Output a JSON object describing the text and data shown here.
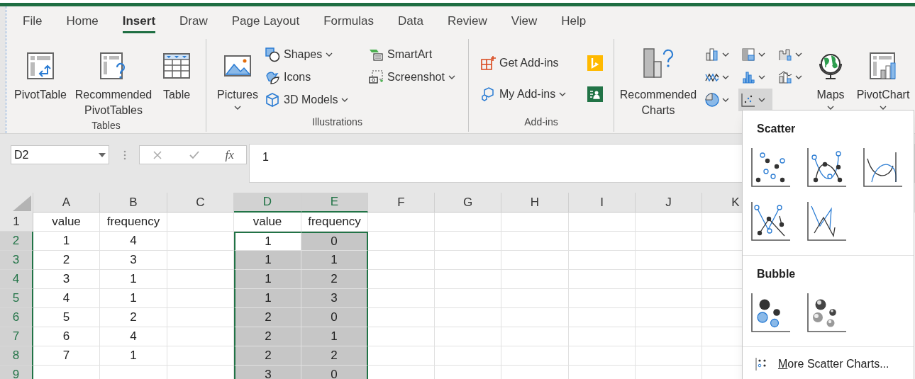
{
  "ribbon_tabs": [
    {
      "label": "File",
      "selected": false
    },
    {
      "label": "Home",
      "selected": false
    },
    {
      "label": "Insert",
      "selected": true
    },
    {
      "label": "Draw",
      "selected": false
    },
    {
      "label": "Page Layout",
      "selected": false
    },
    {
      "label": "Formulas",
      "selected": false
    },
    {
      "label": "Data",
      "selected": false
    },
    {
      "label": "Review",
      "selected": false
    },
    {
      "label": "View",
      "selected": false
    },
    {
      "label": "Help",
      "selected": false
    }
  ],
  "tables_group": {
    "label": "Tables",
    "buttons": [
      {
        "kind": "pivot-table",
        "label": "PivotTable"
      },
      {
        "kind": "recommended-pivot",
        "label": "Recommended PivotTables"
      },
      {
        "kind": "table",
        "label": "Table"
      }
    ]
  },
  "illustrations_group": {
    "label": "Illustrations",
    "pictures": {
      "kind": "pictures",
      "label": "Pictures",
      "has_menu": true
    },
    "columns": [
      [
        {
          "kind": "shapes",
          "label": "Shapes",
          "has_menu": true
        },
        {
          "kind": "icons",
          "label": "Icons",
          "has_menu": false
        },
        {
          "kind": "models",
          "label": "3D Models",
          "has_menu": true
        }
      ],
      [
        {
          "kind": "smartart",
          "label": "SmartArt",
          "has_menu": false
        },
        {
          "kind": "screenshot",
          "label": "Screenshot",
          "has_menu": true
        }
      ]
    ]
  },
  "addins_group": {
    "label": "Add-ins",
    "rows": [
      {
        "kind": "get-addins",
        "label": "Get Add-ins",
        "has_menu": false,
        "side_button": {
          "kind": "bing"
        }
      },
      {
        "kind": "my-addins",
        "label": "My Add-ins",
        "has_menu": true,
        "side_button": {
          "kind": "people"
        }
      }
    ]
  },
  "charts_group": {
    "recommended": {
      "kind": "recommended-charts",
      "label": "Recommended Charts"
    },
    "chart_buttons": [
      {
        "kind": "column",
        "selected": false
      },
      {
        "kind": "hierarchy",
        "selected": false
      },
      {
        "kind": "waterfall",
        "selected": false
      },
      {
        "kind": "line",
        "selected": false
      },
      {
        "kind": "statistic",
        "selected": false
      },
      {
        "kind": "combo",
        "selected": false
      },
      {
        "kind": "pie",
        "selected": false
      },
      {
        "kind": "scatter",
        "selected": true
      }
    ],
    "large": [
      {
        "kind": "maps",
        "label": "Maps",
        "has_menu": true
      },
      {
        "kind": "pivot-chart",
        "label": "PivotChart",
        "has_menu": true
      }
    ]
  },
  "formula_bar": {
    "name_box": "D2",
    "function_label": "fx",
    "value": "1"
  },
  "sheet": {
    "columns": [
      {
        "label": "A",
        "selected": false
      },
      {
        "label": "B",
        "selected": false
      },
      {
        "label": "C",
        "selected": false
      },
      {
        "label": "D",
        "selected": true
      },
      {
        "label": "E",
        "selected": true
      },
      {
        "label": "F",
        "selected": false
      },
      {
        "label": "G",
        "selected": false
      },
      {
        "label": "H",
        "selected": false
      },
      {
        "label": "I",
        "selected": false
      },
      {
        "label": "J",
        "selected": false
      },
      {
        "label": "K",
        "selected": false
      }
    ],
    "rows": [
      {
        "label": "1",
        "selected": false,
        "a_b": [
          "value",
          "frequency"
        ],
        "d_e": [
          {
            "text": "value",
            "active": false
          },
          {
            "text": "frequency",
            "active": false
          }
        ]
      },
      {
        "label": "2",
        "selected": true,
        "a_b": [
          "1",
          "4"
        ],
        "d_e": [
          {
            "text": "1",
            "active": true
          },
          {
            "text": "0",
            "active": false
          }
        ]
      },
      {
        "label": "3",
        "selected": true,
        "a_b": [
          "2",
          "3"
        ],
        "d_e": [
          {
            "text": "1",
            "active": false
          },
          {
            "text": "1",
            "active": false
          }
        ]
      },
      {
        "label": "4",
        "selected": true,
        "a_b": [
          "3",
          "1"
        ],
        "d_e": [
          {
            "text": "1",
            "active": false
          },
          {
            "text": "2",
            "active": false
          }
        ]
      },
      {
        "label": "5",
        "selected": true,
        "a_b": [
          "4",
          "1"
        ],
        "d_e": [
          {
            "text": "1",
            "active": false
          },
          {
            "text": "3",
            "active": false
          }
        ]
      },
      {
        "label": "6",
        "selected": true,
        "a_b": [
          "5",
          "2"
        ],
        "d_e": [
          {
            "text": "2",
            "active": false
          },
          {
            "text": "0",
            "active": false
          }
        ]
      },
      {
        "label": "7",
        "selected": true,
        "a_b": [
          "6",
          "4"
        ],
        "d_e": [
          {
            "text": "2",
            "active": false
          },
          {
            "text": "1",
            "active": false
          }
        ]
      },
      {
        "label": "8",
        "selected": true,
        "a_b": [
          "7",
          "1"
        ],
        "d_e": [
          {
            "text": "2",
            "active": false
          },
          {
            "text": "2",
            "active": false
          }
        ]
      },
      {
        "label": "9",
        "selected": true,
        "d_e": [
          {
            "text": "3",
            "active": false
          },
          {
            "text": "0",
            "active": false
          }
        ]
      }
    ]
  },
  "scatter_menu": {
    "sections": [
      {
        "title": "Scatter",
        "options": [
          {
            "kind": "markers"
          },
          {
            "kind": "smooth-markers"
          },
          {
            "kind": "smooth"
          },
          {
            "kind": "straight-markers"
          },
          {
            "kind": "straight"
          }
        ]
      },
      {
        "title": "Bubble",
        "options": [
          {
            "kind": "bubble"
          },
          {
            "kind": "bubble-3d"
          }
        ]
      }
    ],
    "footer": "More Scatter Charts..."
  }
}
